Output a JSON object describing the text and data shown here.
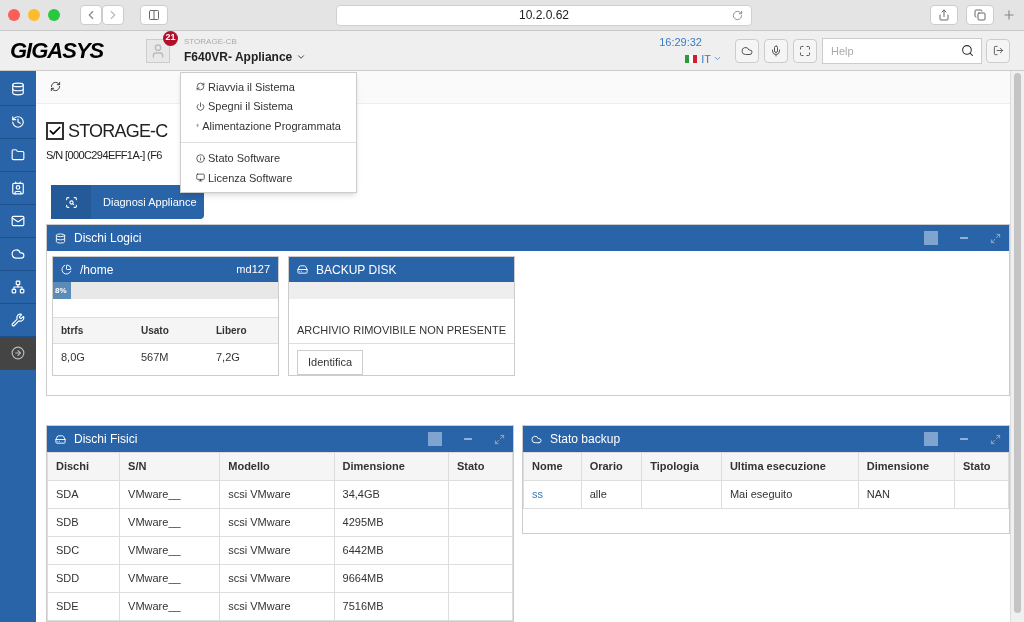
{
  "browser": {
    "url": "10.2.0.62"
  },
  "header": {
    "logo": "GIGASYS",
    "notifications": "21",
    "device_label": "STORAGE-CB",
    "device_name": "F640VR- Appliance",
    "time": "16:29:32",
    "language": "IT",
    "search": {
      "placeholder": "Help"
    }
  },
  "sidebar": {
    "items": [
      {
        "selected": false
      },
      {
        "selected": false
      },
      {
        "selected": false
      },
      {
        "selected": false
      },
      {
        "selected": false
      },
      {
        "selected": false
      },
      {
        "selected": false
      },
      {
        "selected": false
      },
      {
        "selected": true
      }
    ]
  },
  "dropdown": {
    "groups": [
      [
        "Riavvia il Sistema",
        "Spegni il Sistema",
        "Alimentazione Programmata"
      ],
      [
        "Stato Software",
        "Licenza Software"
      ]
    ]
  },
  "page": {
    "title": "STORAGE-C",
    "serial": "S/N [000C294EFF1A-] (F6",
    "title_checked": true,
    "diagnose_button": "Diagnosi Appliance"
  },
  "logical_disks": {
    "title": "Dischi Logici",
    "volume": {
      "name": "/home",
      "device": "md127",
      "usage_label": "8%",
      "level": 0.08,
      "columns": [
        "btrfs",
        "Usato",
        "Libero"
      ],
      "values": [
        "8,0G",
        "567M",
        "7,2G"
      ]
    },
    "backup_disk": {
      "name": "BACKUP DISK",
      "message": "ARCHIVIO RIMOVIBILE NON PRESENTE",
      "button": "Identifica"
    }
  },
  "physical_disks": {
    "title": "Dischi Fisici",
    "columns": [
      "Dischi",
      "S/N",
      "Modello",
      "Dimensione",
      "Stato"
    ],
    "rows": [
      [
        "SDA",
        "VMware__",
        "scsi VMware",
        "34,4GB",
        ""
      ],
      [
        "SDB",
        "VMware__",
        "scsi VMware",
        "4295MB",
        ""
      ],
      [
        "SDC",
        "VMware__",
        "scsi VMware",
        "6442MB",
        ""
      ],
      [
        "SDD",
        "VMware__",
        "scsi VMware",
        "9664MB",
        ""
      ],
      [
        "SDE",
        "VMware__",
        "scsi VMware",
        "7516MB",
        ""
      ]
    ]
  },
  "backup_status": {
    "title": "Stato backup",
    "columns": [
      "Nome",
      "Orario",
      "Tipologia",
      "Ultima esecuzione",
      "Dimensione",
      "Stato"
    ],
    "rows": [
      [
        "ss",
        "alle",
        "",
        "Mai eseguito",
        "NAN",
        ""
      ]
    ]
  }
}
